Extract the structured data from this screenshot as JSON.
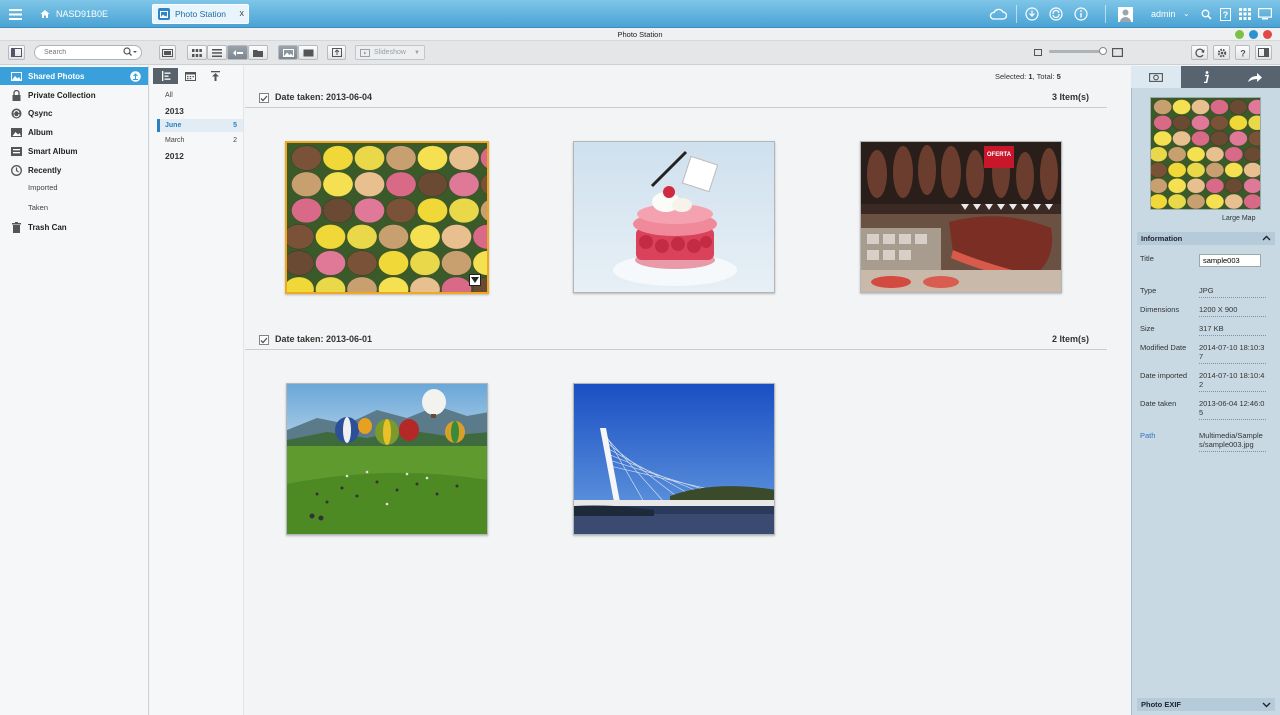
{
  "taskbar": {
    "nas_name": "NASD91B0E",
    "app_tab_label": "Photo Station",
    "close_glyph": "x",
    "user": "admin"
  },
  "window": {
    "title": "Photo Station"
  },
  "toolbar": {
    "search_placeholder": "Search",
    "slideshow_label": "Slideshow"
  },
  "sidebar": {
    "items": [
      {
        "label": "Shared Photos",
        "icon": "shared-photos-icon"
      },
      {
        "label": "Private Collection",
        "icon": "lock-icon"
      },
      {
        "label": "Qsync",
        "icon": "sync-icon"
      },
      {
        "label": "Album",
        "icon": "album-icon"
      },
      {
        "label": "Smart Album",
        "icon": "smart-album-icon"
      },
      {
        "label": "Recently",
        "icon": "clock-icon"
      },
      {
        "label": "Trash Can",
        "icon": "trash-icon"
      }
    ],
    "recently_sub": [
      "Imported",
      "Taken"
    ]
  },
  "timeline": {
    "all_label": "All",
    "years": [
      {
        "year": "2013",
        "months": [
          {
            "name": "June",
            "count": "5"
          },
          {
            "name": "March",
            "count": "2"
          }
        ]
      },
      {
        "year": "2012",
        "months": []
      }
    ]
  },
  "main": {
    "selected_label": "Selected:",
    "selected_count": "1",
    "total_label": ", Total:",
    "total_count": "5",
    "groups": [
      {
        "title": "Date taken: 2013-06-04",
        "count": "3 Item(s)"
      },
      {
        "title": "Date taken: 2013-06-01",
        "count": "2 Item(s)"
      }
    ],
    "sign_text": "OFERTA"
  },
  "info": {
    "large_map": "Large Map",
    "section_info": "Information",
    "section_exif": "Photo EXIF",
    "title_label": "Title",
    "title_value": "sample003",
    "type_label": "Type",
    "type_value": "JPG",
    "dimensions_label": "Dimensions",
    "dimensions_value": "1200 X 900",
    "size_label": "Size",
    "size_value": "317 KB",
    "modified_label": "Modified Date",
    "modified_value": "2014-07-10 18:10:37",
    "imported_label": "Date imported",
    "imported_value": "2014-07-10 18:10:42",
    "taken_label": "Date taken",
    "taken_value": "2013-06-04 12:46:05",
    "path_label": "Path",
    "path_value": "Multimedia/Samples/sample003.jpg"
  },
  "colors": {
    "accent": "#3aa0dc",
    "selection": "#f0a81e",
    "taskbar": "#4aa3d4"
  }
}
